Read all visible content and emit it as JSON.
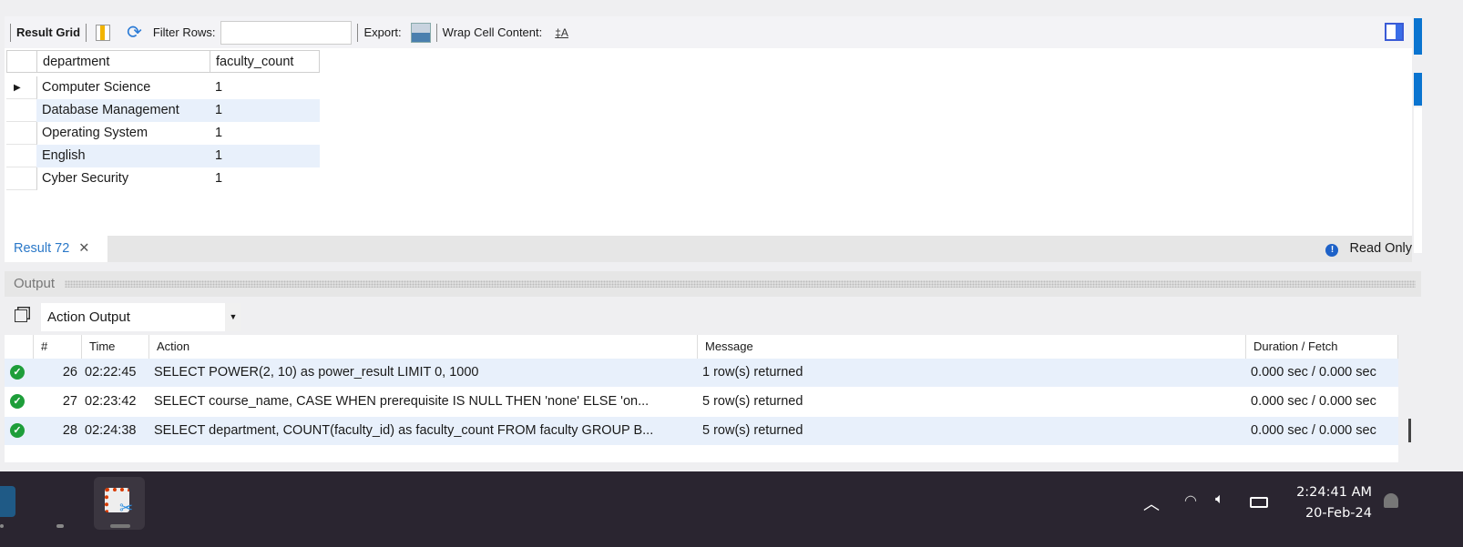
{
  "toolbar": {
    "result_grid": "Result Grid",
    "filter_rows": "Filter Rows:",
    "filter_value": "",
    "export": "Export:",
    "wrap": "Wrap Cell Content:"
  },
  "grid": {
    "columns": [
      "department",
      "faculty_count"
    ],
    "rows": [
      [
        "Computer Science",
        "1"
      ],
      [
        "Database Management",
        "1"
      ],
      [
        "Operating System",
        "1"
      ],
      [
        "English",
        "1"
      ],
      [
        "Cyber Security",
        "1"
      ]
    ]
  },
  "tabs": {
    "result_tab": "Result 72",
    "read_only": "Read Only"
  },
  "output": {
    "title": "Output",
    "dropdown": "Action Output",
    "columns": [
      "#",
      "Time",
      "Action",
      "Message",
      "Duration / Fetch"
    ],
    "rows": [
      {
        "num": "26",
        "time": "02:22:45",
        "action": "SELECT POWER(2, 10) as power_result LIMIT 0, 1000",
        "message": "1 row(s) returned",
        "duration": "0.000 sec / 0.000 sec"
      },
      {
        "num": "27",
        "time": "02:23:42",
        "action": "SELECT course_name, CASE WHEN prerequisite IS NULL THEN 'none' ELSE 'on...",
        "message": "5 row(s) returned",
        "duration": "0.000 sec / 0.000 sec"
      },
      {
        "num": "28",
        "time": "02:24:38",
        "action": "SELECT department, COUNT(faculty_id) as faculty_count FROM faculty GROUP B...",
        "message": "5 row(s) returned",
        "duration": "0.000 sec / 0.000 sec"
      }
    ]
  },
  "taskbar": {
    "time": "2:24:41 AM",
    "date": "20-Feb-24"
  }
}
